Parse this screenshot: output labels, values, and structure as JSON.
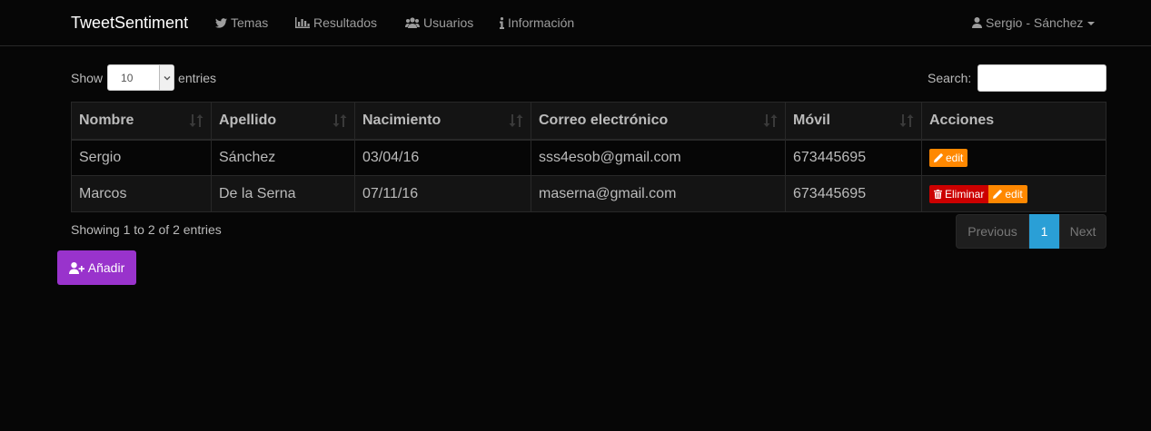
{
  "navbar": {
    "brand": "TweetSentiment",
    "items": [
      {
        "label": "Temas",
        "icon": "twitter-icon"
      },
      {
        "label": "Resultados",
        "icon": "bar-chart-icon"
      },
      {
        "label": "Usuarios",
        "icon": "users-icon"
      },
      {
        "label": "Información",
        "icon": "info-icon"
      }
    ],
    "user": "Sergio - Sánchez"
  },
  "length": {
    "show_label": "Show",
    "selected": "10",
    "entries_label": "entries"
  },
  "search": {
    "label": "Search:",
    "value": ""
  },
  "table": {
    "headers": [
      "Nombre",
      "Apellido",
      "Nacimiento",
      "Correo electrónico",
      "Móvil",
      "Acciones"
    ],
    "rows": [
      {
        "nombre": "Sergio",
        "apellido": "Sánchez",
        "nacimiento": "03/04/16",
        "correo": "sss4esob@gmail.com",
        "movil": "673445695"
      },
      {
        "nombre": "Marcos",
        "apellido": "De la Serna",
        "nacimiento": "07/11/16",
        "correo": "maserna@gmail.com",
        "movil": "673445695"
      }
    ],
    "edit_label": "edit",
    "delete_label": "Eliminar"
  },
  "info": "Showing 1 to 2 of 2 entries",
  "pagination": {
    "previous": "Previous",
    "current": "1",
    "next": "Next"
  },
  "add_button": "Añadir",
  "colors": {
    "accent": "#2a9fd6",
    "edit": "#ff8800",
    "delete": "#cc0000",
    "add": "#9933cc",
    "background": "#060606"
  }
}
